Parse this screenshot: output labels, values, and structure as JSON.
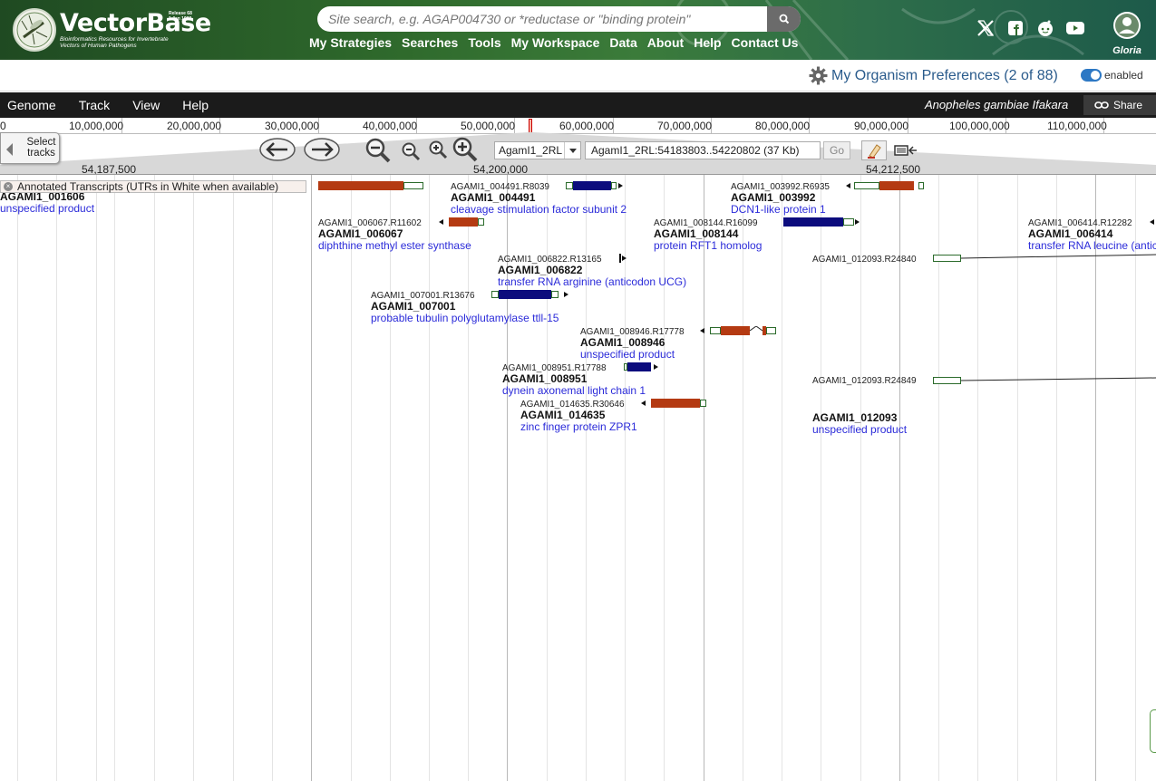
{
  "header": {
    "logo_name": "VectorBase",
    "logo_tagline": "Bioinformatics Resources for Invertebrate Vectors of Human Pathogens",
    "release": "Release 68",
    "release_date": "1 Jan 1900",
    "search_placeholder": "Site search, e.g. AGAP004730 or *reductase or \"binding protein\"",
    "nav": [
      "My Strategies",
      "Searches",
      "Tools",
      "My Workspace",
      "Data",
      "About",
      "Help",
      "Contact Us"
    ],
    "social_icons": [
      "x-icon",
      "facebook-icon",
      "reddit-icon",
      "youtube-icon"
    ],
    "user_name": "Gloria"
  },
  "prefs": {
    "label": "My Organism Preferences (2 of 88)",
    "toggle_label": "enabled",
    "toggle_on": true
  },
  "jbrowse": {
    "menus": [
      "Genome",
      "Track",
      "View",
      "Help"
    ],
    "dataset": "Anopheles gambiae Ifakara",
    "share_label": "Share",
    "overview_ticks": [
      "0",
      "10,000,000",
      "20,000,000",
      "30,000,000",
      "40,000,000",
      "50,000,000",
      "60,000,000",
      "70,000,000",
      "80,000,000",
      "90,000,000",
      "100,000,000",
      "110,000,000"
    ],
    "select_tracks_label": "Select tracks",
    "ref_seq": "AgamI1_2RL",
    "location": "AgamI1_2RL:54183803..54220802 (37 Kb)",
    "go_label": "Go",
    "scale_labels": [
      "54,187,500",
      "54,200,000",
      "54,212,500"
    ],
    "track_label": "Annotated Transcripts (UTRs in White when available)"
  },
  "features": [
    {
      "id": "",
      "gene": "AGAMI1_001606",
      "desc": "unspecified product"
    },
    {
      "id": "AGAMI1_004491.R8039",
      "gene": "AGAMI1_004491",
      "desc": "cleavage stimulation factor subunit 2"
    },
    {
      "id": "AGAMI1_003992.R6935",
      "gene": "AGAMI1_003992",
      "desc": "DCN1-like protein 1"
    },
    {
      "id": "AGAMI1_006067.R11602",
      "gene": "AGAMI1_006067",
      "desc": "diphthine methyl ester synthase"
    },
    {
      "id": "AGAMI1_008144.R16099",
      "gene": "AGAMI1_008144",
      "desc": "protein RFT1 homolog"
    },
    {
      "id": "AGAMI1_006414.R12282",
      "gene": "AGAMI1_006414",
      "desc": "transfer RNA leucine (antic"
    },
    {
      "id": "AGAMI1_006822.R13165",
      "gene": "AGAMI1_006822",
      "desc": "transfer RNA arginine (anticodon UCG)"
    },
    {
      "id": "AGAMI1_012093.R24840",
      "gene": "",
      "desc": ""
    },
    {
      "id": "AGAMI1_007001.R13676",
      "gene": "AGAMI1_007001",
      "desc": "probable tubulin polyglutamylase ttll-15"
    },
    {
      "id": "AGAMI1_008946.R17778",
      "gene": "AGAMI1_008946",
      "desc": "unspecified product"
    },
    {
      "id": "AGAMI1_008951.R17788",
      "gene": "AGAMI1_008951",
      "desc": "dynein axonemal light chain 1"
    },
    {
      "id": "AGAMI1_012093.R24849",
      "gene": "",
      "desc": ""
    },
    {
      "id": "AGAMI1_014635.R30646",
      "gene": "AGAMI1_014635",
      "desc": "zinc finger protein ZPR1"
    },
    {
      "id": "",
      "gene": "AGAMI1_012093",
      "desc": "unspecified product"
    }
  ],
  "colors": {
    "header_green": "#2f6a2c",
    "exon_red": "#b43a12",
    "exon_blue": "#0c0c7d",
    "link_blue": "#2b2bd9",
    "pref_blue": "#2a5b8c"
  }
}
